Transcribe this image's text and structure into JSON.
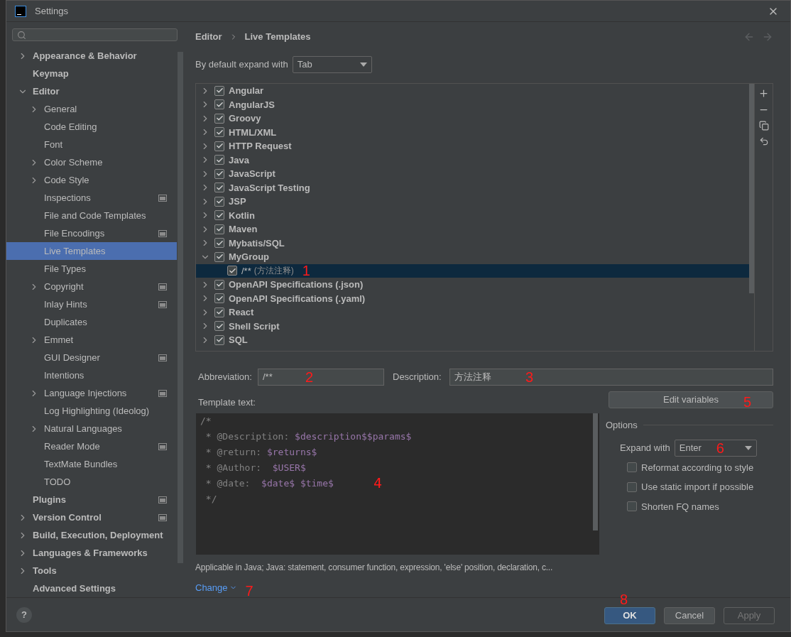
{
  "window": {
    "title": "Settings"
  },
  "sidebar": {
    "items": [
      {
        "label": "Appearance & Behavior",
        "expandable": true,
        "expanded": false,
        "selected": false,
        "badge": false
      },
      {
        "label": "Keymap",
        "expandable": false,
        "expanded": false,
        "selected": false,
        "badge": false
      },
      {
        "label": "Editor",
        "expandable": true,
        "expanded": true,
        "selected": false,
        "badge": false,
        "children": [
          {
            "label": "General",
            "expandable": true,
            "expanded": false,
            "selected": false,
            "badge": false
          },
          {
            "label": "Code Editing",
            "expandable": false,
            "expanded": false,
            "selected": false,
            "badge": false
          },
          {
            "label": "Font",
            "expandable": false,
            "expanded": false,
            "selected": false,
            "badge": false
          },
          {
            "label": "Color Scheme",
            "expandable": true,
            "expanded": false,
            "selected": false,
            "badge": false
          },
          {
            "label": "Code Style",
            "expandable": true,
            "expanded": false,
            "selected": false,
            "badge": false
          },
          {
            "label": "Inspections",
            "expandable": false,
            "expanded": false,
            "selected": false,
            "badge": true
          },
          {
            "label": "File and Code Templates",
            "expandable": false,
            "expanded": false,
            "selected": false,
            "badge": false
          },
          {
            "label": "File Encodings",
            "expandable": false,
            "expanded": false,
            "selected": false,
            "badge": true
          },
          {
            "label": "Live Templates",
            "expandable": false,
            "expanded": false,
            "selected": true,
            "badge": false
          },
          {
            "label": "File Types",
            "expandable": false,
            "expanded": false,
            "selected": false,
            "badge": false
          },
          {
            "label": "Copyright",
            "expandable": true,
            "expanded": false,
            "selected": false,
            "badge": true
          },
          {
            "label": "Inlay Hints",
            "expandable": false,
            "expanded": false,
            "selected": false,
            "badge": true
          },
          {
            "label": "Duplicates",
            "expandable": false,
            "expanded": false,
            "selected": false,
            "badge": false
          },
          {
            "label": "Emmet",
            "expandable": true,
            "expanded": false,
            "selected": false,
            "badge": false
          },
          {
            "label": "GUI Designer",
            "expandable": false,
            "expanded": false,
            "selected": false,
            "badge": true
          },
          {
            "label": "Intentions",
            "expandable": false,
            "expanded": false,
            "selected": false,
            "badge": false
          },
          {
            "label": "Language Injections",
            "expandable": true,
            "expanded": false,
            "selected": false,
            "badge": true
          },
          {
            "label": "Log Highlighting (Ideolog)",
            "expandable": false,
            "expanded": false,
            "selected": false,
            "badge": false
          },
          {
            "label": "Natural Languages",
            "expandable": true,
            "expanded": false,
            "selected": false,
            "badge": false
          },
          {
            "label": "Reader Mode",
            "expandable": false,
            "expanded": false,
            "selected": false,
            "badge": true
          },
          {
            "label": "TextMate Bundles",
            "expandable": false,
            "expanded": false,
            "selected": false,
            "badge": false
          },
          {
            "label": "TODO",
            "expandable": false,
            "expanded": false,
            "selected": false,
            "badge": false
          }
        ]
      },
      {
        "label": "Plugins",
        "expandable": false,
        "expanded": false,
        "selected": false,
        "badge": true
      },
      {
        "label": "Version Control",
        "expandable": true,
        "expanded": false,
        "selected": false,
        "badge": true
      },
      {
        "label": "Build, Execution, Deployment",
        "expandable": true,
        "expanded": false,
        "selected": false,
        "badge": false
      },
      {
        "label": "Languages & Frameworks",
        "expandable": true,
        "expanded": false,
        "selected": false,
        "badge": false
      },
      {
        "label": "Tools",
        "expandable": true,
        "expanded": false,
        "selected": false,
        "badge": false
      },
      {
        "label": "Advanced Settings",
        "expandable": false,
        "expanded": false,
        "selected": false,
        "badge": false
      }
    ]
  },
  "breadcrumb": [
    "Editor",
    "Live Templates"
  ],
  "default_expand": {
    "label": "By default expand with",
    "value": "Tab"
  },
  "template_groups": [
    {
      "label": "Angular",
      "checked": true,
      "expanded": false,
      "selected": false
    },
    {
      "label": "AngularJS",
      "checked": true,
      "expanded": false,
      "selected": false
    },
    {
      "label": "Groovy",
      "checked": true,
      "expanded": false,
      "selected": false
    },
    {
      "label": "HTML/XML",
      "checked": true,
      "expanded": false,
      "selected": false
    },
    {
      "label": "HTTP Request",
      "checked": true,
      "expanded": false,
      "selected": false
    },
    {
      "label": "Java",
      "checked": true,
      "expanded": false,
      "selected": false
    },
    {
      "label": "JavaScript",
      "checked": true,
      "expanded": false,
      "selected": false
    },
    {
      "label": "JavaScript Testing",
      "checked": true,
      "expanded": false,
      "selected": false
    },
    {
      "label": "JSP",
      "checked": true,
      "expanded": false,
      "selected": false
    },
    {
      "label": "Kotlin",
      "checked": true,
      "expanded": false,
      "selected": false
    },
    {
      "label": "Maven",
      "checked": true,
      "expanded": false,
      "selected": false
    },
    {
      "label": "Mybatis/SQL",
      "checked": true,
      "expanded": false,
      "selected": false
    },
    {
      "label": "MyGroup",
      "checked": true,
      "expanded": true,
      "selected": false,
      "children": [
        {
          "label": "/**",
          "description": "(方法注释)",
          "checked": true,
          "selected": true,
          "annotation": "1"
        }
      ]
    },
    {
      "label": "OpenAPI Specifications (.json)",
      "checked": true,
      "expanded": false,
      "selected": false
    },
    {
      "label": "OpenAPI Specifications (.yaml)",
      "checked": true,
      "expanded": false,
      "selected": false
    },
    {
      "label": "React",
      "checked": true,
      "expanded": false,
      "selected": false
    },
    {
      "label": "Shell Script",
      "checked": true,
      "expanded": false,
      "selected": false
    },
    {
      "label": "SQL",
      "checked": true,
      "expanded": false,
      "selected": false
    }
  ],
  "abbreviation": {
    "label": "Abbreviation:",
    "value": "/**",
    "annotation": "2"
  },
  "description": {
    "label": "Description:",
    "value": "方法注释",
    "annotation": "3"
  },
  "template_text": {
    "label": "Template text:",
    "annotation": "4",
    "lines": [
      [
        {
          "kind": "comment",
          "text": "/*"
        }
      ],
      [
        {
          "kind": "comment",
          "text": " * @Description: "
        },
        {
          "kind": "variable",
          "text": "$description$$params$"
        }
      ],
      [
        {
          "kind": "comment",
          "text": " * @return: "
        },
        {
          "kind": "variable",
          "text": "$returns$"
        }
      ],
      [
        {
          "kind": "comment",
          "text": " * @Author:  "
        },
        {
          "kind": "variable",
          "text": "$USER$"
        }
      ],
      [
        {
          "kind": "comment",
          "text": " * @date:  "
        },
        {
          "kind": "variable",
          "text": "$date$ $time$"
        }
      ],
      [
        {
          "kind": "comment",
          "text": " */"
        }
      ]
    ]
  },
  "edit_variables": {
    "label": "Edit variables",
    "annotation": "5"
  },
  "options": {
    "title": "Options",
    "expand_with": {
      "label": "Expand with",
      "value": "Enter",
      "annotation": "6"
    },
    "checkboxes": [
      {
        "label": "Reformat according to style",
        "checked": false
      },
      {
        "label": "Use static import if possible",
        "checked": false
      },
      {
        "label": "Shorten FQ names",
        "checked": false
      }
    ]
  },
  "applicable": "Applicable in Java; Java: statement, consumer function, expression, 'else' position, declaration, c...",
  "change_link": {
    "label": "Change",
    "annotation": "7"
  },
  "footer": {
    "help": "?",
    "buttons": [
      {
        "label": "OK",
        "primary": true,
        "disabled": false,
        "annotation": "8"
      },
      {
        "label": "Cancel",
        "primary": false,
        "disabled": false
      },
      {
        "label": "Apply",
        "primary": false,
        "disabled": true
      }
    ]
  }
}
